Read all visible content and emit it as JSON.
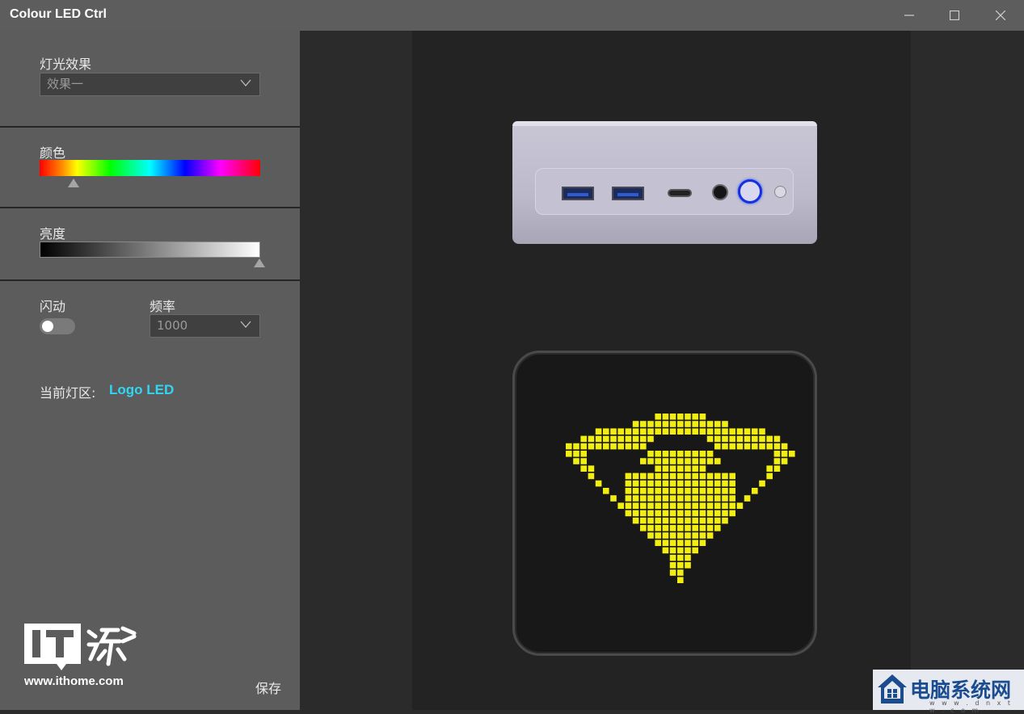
{
  "window": {
    "title": "Colour LED Ctrl",
    "controls": [
      "minimize-icon",
      "maximize-icon",
      "close-icon"
    ]
  },
  "sidebar": {
    "effect": {
      "label": "灯光效果",
      "value": "效果一"
    },
    "color": {
      "label": "颜色",
      "position": 0.15
    },
    "brightness": {
      "label": "亮度",
      "position": 1.0
    },
    "flash": {
      "label": "闪动",
      "enabled": false
    },
    "frequency": {
      "label": "频率",
      "value": "1000"
    },
    "zone": {
      "label": "当前灯区:",
      "value": "Logo LED"
    },
    "save_label": "保存"
  },
  "watermark": {
    "logo_text": "IT之家",
    "url": "www.ithome.com"
  },
  "preview": {
    "led_color": "#f2ee12",
    "power_ring_color": "#1530e0"
  },
  "brand": {
    "name": "电脑系统网",
    "url": "w w w . d n x t w . c o m"
  },
  "colors": {
    "accent": "#2fd7f3",
    "sidebar": "#5c5c5c",
    "titlebar": "#5d5d5d"
  }
}
